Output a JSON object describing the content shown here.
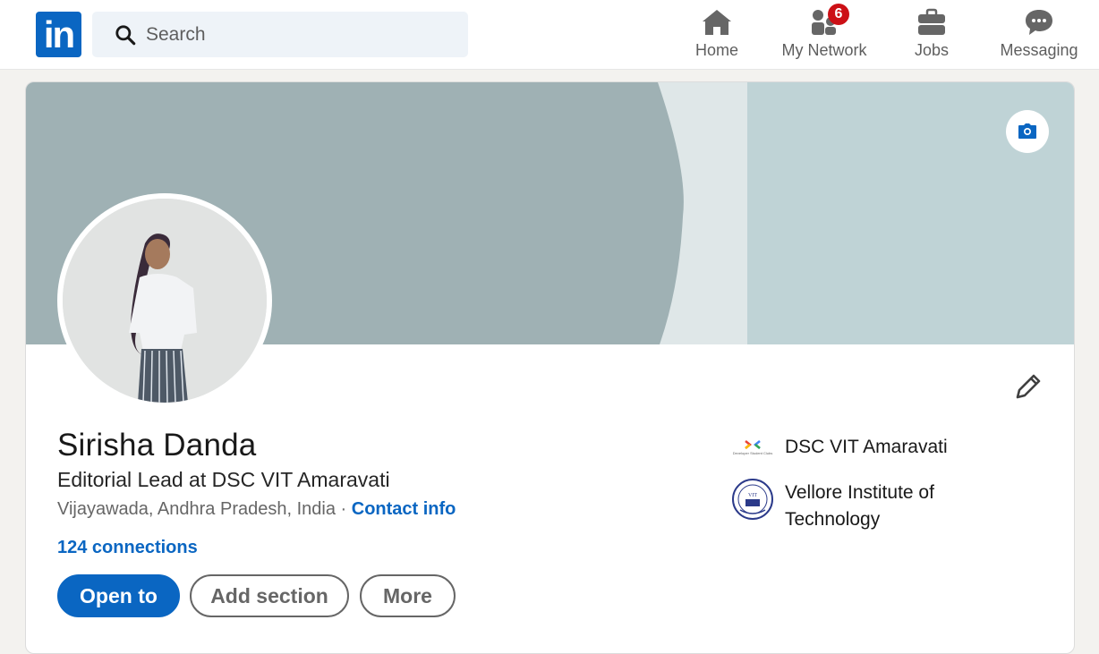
{
  "nav": {
    "search_placeholder": "Search",
    "items": [
      {
        "label": "Home",
        "icon": "home-icon"
      },
      {
        "label": "My Network",
        "icon": "network-icon",
        "badge": "6"
      },
      {
        "label": "Jobs",
        "icon": "briefcase-icon"
      },
      {
        "label": "Messaging",
        "icon": "messaging-icon"
      }
    ],
    "brand_color": "#0a66c2",
    "badge_color": "#cc1016"
  },
  "profile": {
    "name": "Sirisha Danda",
    "headline": "Editorial Lead at DSC VIT Amaravati",
    "location": "Vijayawada, Andhra Pradesh, India",
    "separator": " · ",
    "contact_info": "Contact info",
    "connections": "124 connections",
    "buttons": {
      "open_to": "Open to",
      "add_section": "Add section",
      "more": "More"
    },
    "organizations": [
      {
        "name": "DSC VIT Amaravati",
        "logo": "dsc-logo",
        "logo_caption": "Developer Student Clubs"
      },
      {
        "name_line1": "Vellore Institute of",
        "name_line2": "Technology",
        "logo": "vit-seal-logo",
        "logo_caption": "VIT"
      }
    ],
    "banner_colors": [
      "#9fb1b4",
      "#dfe7e8",
      "#bfd3d6"
    ]
  }
}
